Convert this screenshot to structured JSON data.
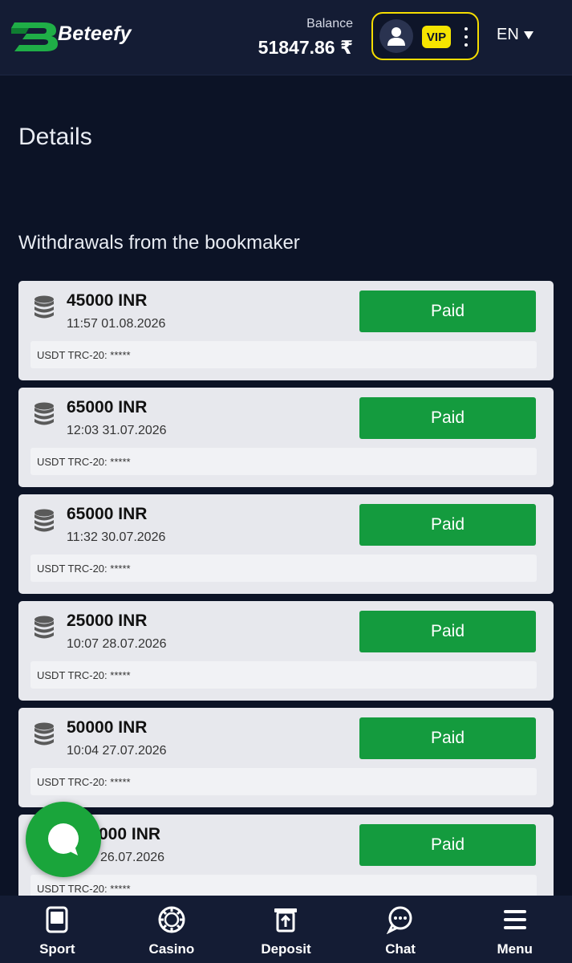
{
  "header": {
    "logo_text": "Beteefy",
    "balance_label": "Balance",
    "balance_value": "51847.86 ₹",
    "vip_label": "VIP",
    "language": "EN",
    "accent_color": "#f5dd00"
  },
  "page": {
    "title": "Details",
    "section_title": "Withdrawals from the bookmaker"
  },
  "withdrawals": [
    {
      "amount": "45000 INR",
      "datetime": "11:57 01.08.2026",
      "status": "Paid",
      "method": "USDT TRC-20: *****"
    },
    {
      "amount": "65000 INR",
      "datetime": "12:03 31.07.2026",
      "status": "Paid",
      "method": "USDT TRC-20: *****"
    },
    {
      "amount": "65000 INR",
      "datetime": "11:32 30.07.2026",
      "status": "Paid",
      "method": "USDT TRC-20: *****"
    },
    {
      "amount": "25000 INR",
      "datetime": "10:07 28.07.2026",
      "status": "Paid",
      "method": "USDT TRC-20: *****"
    },
    {
      "amount": "50000 INR",
      "datetime": "10:04 27.07.2026",
      "status": "Paid",
      "method": "USDT TRC-20: *****"
    },
    {
      "amount": "000 INR",
      "datetime": "26.07.2026",
      "status": "Paid",
      "method": "USDT TRC-20: *****"
    }
  ],
  "status_color": "#149b3e",
  "bottom_nav": [
    {
      "label": "Sport",
      "icon": "sport-icon"
    },
    {
      "label": "Casino",
      "icon": "casino-chip-icon"
    },
    {
      "label": "Deposit",
      "icon": "deposit-icon"
    },
    {
      "label": "Chat",
      "icon": "chat-icon"
    },
    {
      "label": "Menu",
      "icon": "menu-icon"
    }
  ]
}
